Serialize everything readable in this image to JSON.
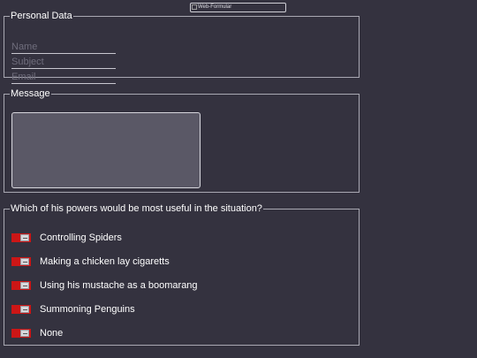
{
  "header": {
    "image_alt": "Web-Formular"
  },
  "personal": {
    "legend": "Personal Data",
    "name_placeholder": "Name",
    "subject_placeholder": "Subject",
    "email_placeholder": "Email"
  },
  "message": {
    "legend": "Message",
    "value": ""
  },
  "powers": {
    "legend": "Which of his powers would be most useful in the situation?",
    "options": [
      {
        "label": "Controlling Spiders",
        "checked": false
      },
      {
        "label": "Making a chicken lay cigaretts",
        "checked": false
      },
      {
        "label": "Using his mustache as a boomarang",
        "checked": false
      },
      {
        "label": "Summoning Penguins",
        "checked": false
      },
      {
        "label": "None",
        "checked": false
      }
    ]
  },
  "colors": {
    "background": "#34323f",
    "toggle_off": "#cc1616",
    "border": "#a9a8b2"
  },
  "icons": {
    "toggle": "toggle-switch-icon",
    "broken_image": "broken-image-icon"
  }
}
